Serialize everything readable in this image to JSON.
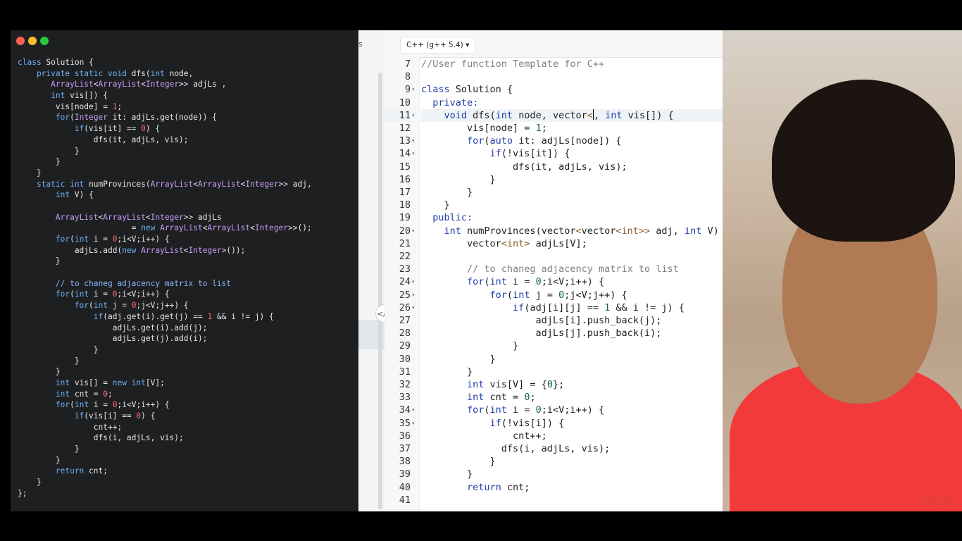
{
  "java_editor": {
    "lines": [
      [
        [
          "class ",
          "k"
        ],
        [
          "Solution",
          ""
        ],
        [
          " {",
          ""
        ]
      ],
      [
        [
          "    private static void ",
          "k"
        ],
        [
          "dfs",
          ""
        ],
        [
          "(",
          ""
        ],
        [
          "int",
          "k"
        ],
        [
          " node,",
          ""
        ]
      ],
      [
        [
          "       ",
          ""
        ],
        [
          "ArrayList",
          "t"
        ],
        [
          "<",
          ""
        ],
        [
          "ArrayList",
          "t"
        ],
        [
          "<",
          ""
        ],
        [
          "Integer",
          "t"
        ],
        [
          ">> adjLs ,",
          ""
        ]
      ],
      [
        [
          "       int",
          "k"
        ],
        [
          " vis[]) {",
          ""
        ]
      ],
      [
        [
          "        vis[node] = ",
          ""
        ],
        [
          "1",
          "n"
        ],
        [
          ";",
          ""
        ]
      ],
      [
        [
          "        for",
          "k"
        ],
        [
          "(",
          ""
        ],
        [
          "Integer",
          "t"
        ],
        [
          " it: adjLs.get(node)) {",
          ""
        ]
      ],
      [
        [
          "            if",
          "k"
        ],
        [
          "(vis[it] == ",
          ""
        ],
        [
          "0",
          "n"
        ],
        [
          ") {",
          ""
        ]
      ],
      [
        [
          "                dfs(it, adjLs, vis);",
          ""
        ]
      ],
      [
        [
          "            }",
          ""
        ]
      ],
      [
        [
          "        }",
          ""
        ]
      ],
      [
        [
          "    }",
          ""
        ]
      ],
      [
        [
          "    static int ",
          "k"
        ],
        [
          "numProvinces",
          ""
        ],
        [
          "(",
          ""
        ],
        [
          "ArrayList",
          "t"
        ],
        [
          "<",
          ""
        ],
        [
          "ArrayList",
          "t"
        ],
        [
          "<",
          ""
        ],
        [
          "Integer",
          "t"
        ],
        [
          ">> adj,",
          ""
        ]
      ],
      [
        [
          "        int",
          "k"
        ],
        [
          " V) {",
          ""
        ]
      ],
      [
        [
          "",
          ""
        ]
      ],
      [
        [
          "        ",
          ""
        ],
        [
          "ArrayList",
          "t"
        ],
        [
          "<",
          ""
        ],
        [
          "ArrayList",
          "t"
        ],
        [
          "<",
          ""
        ],
        [
          "Integer",
          "t"
        ],
        [
          ">> adjLs",
          ""
        ]
      ],
      [
        [
          "                        = ",
          ""
        ],
        [
          "new ",
          "k"
        ],
        [
          "ArrayList",
          "t"
        ],
        [
          "<",
          ""
        ],
        [
          "ArrayList",
          "t"
        ],
        [
          "<",
          ""
        ],
        [
          "Integer",
          "t"
        ],
        [
          ">>();",
          ""
        ]
      ],
      [
        [
          "        for",
          "k"
        ],
        [
          "(",
          ""
        ],
        [
          "int",
          "k"
        ],
        [
          " i = ",
          ""
        ],
        [
          "0",
          "n"
        ],
        [
          ";i<V;i++) {",
          ""
        ]
      ],
      [
        [
          "            adjLs.add(",
          ""
        ],
        [
          "new ",
          "k"
        ],
        [
          "ArrayList",
          "t"
        ],
        [
          "<",
          ""
        ],
        [
          "Integer",
          "t"
        ],
        [
          ">());",
          ""
        ]
      ],
      [
        [
          "        }",
          ""
        ]
      ],
      [
        [
          "",
          ""
        ]
      ],
      [
        [
          "        // to chaneg adjacency matrix to list",
          "c"
        ]
      ],
      [
        [
          "        for",
          "k"
        ],
        [
          "(",
          ""
        ],
        [
          "int",
          "k"
        ],
        [
          " i = ",
          ""
        ],
        [
          "0",
          "n"
        ],
        [
          ";i<V;i++) {",
          ""
        ]
      ],
      [
        [
          "            for",
          "k"
        ],
        [
          "(",
          ""
        ],
        [
          "int",
          "k"
        ],
        [
          " j = ",
          ""
        ],
        [
          "0",
          "n"
        ],
        [
          ";j<V;j++) {",
          ""
        ]
      ],
      [
        [
          "                if",
          "k"
        ],
        [
          "(adj.get(i).get(j) == ",
          ""
        ],
        [
          "1",
          "n"
        ],
        [
          " && i != j) {",
          ""
        ]
      ],
      [
        [
          "                    adjLs.get(i).add(j);",
          ""
        ]
      ],
      [
        [
          "                    adjLs.get(j).add(i);",
          ""
        ]
      ],
      [
        [
          "                }",
          ""
        ]
      ],
      [
        [
          "            }",
          ""
        ]
      ],
      [
        [
          "        }",
          ""
        ]
      ],
      [
        [
          "        int",
          "k"
        ],
        [
          " vis[] = ",
          ""
        ],
        [
          "new int",
          "k"
        ],
        [
          "[V];",
          ""
        ]
      ],
      [
        [
          "        int",
          "k"
        ],
        [
          " cnt = ",
          ""
        ],
        [
          "0",
          "n"
        ],
        [
          ";",
          ""
        ]
      ],
      [
        [
          "        for",
          "k"
        ],
        [
          "(",
          ""
        ],
        [
          "int",
          "k"
        ],
        [
          " i = ",
          ""
        ],
        [
          "0",
          "n"
        ],
        [
          ";i<V;i++) {",
          ""
        ]
      ],
      [
        [
          "            if",
          "k"
        ],
        [
          "(vis[i] == ",
          ""
        ],
        [
          "0",
          "n"
        ],
        [
          ") {",
          ""
        ]
      ],
      [
        [
          "                cnt++;",
          ""
        ]
      ],
      [
        [
          "                dfs(i, adjLs, vis);",
          ""
        ]
      ],
      [
        [
          "            }",
          ""
        ]
      ],
      [
        [
          "        }",
          ""
        ]
      ],
      [
        [
          "        return",
          "k"
        ],
        [
          " cnt;",
          ""
        ]
      ],
      [
        [
          "    }",
          ""
        ]
      ],
      [
        [
          "};",
          ""
        ]
      ]
    ]
  },
  "middle": {
    "edge_text": "s",
    "splitter_icon": "</>"
  },
  "cpp_editor": {
    "language": "C++ (g++ 5.4)",
    "active_line": 11,
    "folds": [
      9,
      11,
      13,
      14,
      20,
      24,
      25,
      26,
      34,
      35
    ],
    "lines": [
      {
        "n": 7,
        "t": [
          [
            "//User function Template for C++",
            "c"
          ]
        ]
      },
      {
        "n": 8,
        "t": [
          [
            "",
            ""
          ]
        ]
      },
      {
        "n": 9,
        "t": [
          [
            "class ",
            "k"
          ],
          [
            "Solution {",
            ""
          ]
        ]
      },
      {
        "n": 10,
        "t": [
          [
            "  private:",
            "k"
          ]
        ]
      },
      {
        "n": 11,
        "t": [
          [
            "    void ",
            "k"
          ],
          [
            "dfs(",
            ""
          ],
          [
            "int",
            "k"
          ],
          [
            " node, vector",
            ""
          ],
          [
            "<",
            "t"
          ],
          [
            "|",
            "caret"
          ],
          [
            ", ",
            ""
          ],
          [
            "int",
            "k"
          ],
          [
            " vis[]) {",
            ""
          ]
        ]
      },
      {
        "n": 12,
        "t": [
          [
            "        vis[node] = ",
            ""
          ],
          [
            "1",
            "n"
          ],
          [
            ";",
            ""
          ]
        ]
      },
      {
        "n": 13,
        "t": [
          [
            "        for",
            "k"
          ],
          [
            "(",
            ""
          ],
          [
            "auto",
            "k"
          ],
          [
            " it: adjLs[node]) {",
            ""
          ]
        ]
      },
      {
        "n": 14,
        "t": [
          [
            "            if",
            "k"
          ],
          [
            "(!vis[it]) {",
            ""
          ]
        ]
      },
      {
        "n": 15,
        "t": [
          [
            "                dfs(it, adjLs, vis);",
            ""
          ]
        ]
      },
      {
        "n": 16,
        "t": [
          [
            "            }",
            ""
          ]
        ]
      },
      {
        "n": 17,
        "t": [
          [
            "        }",
            ""
          ]
        ]
      },
      {
        "n": 18,
        "t": [
          [
            "    }",
            ""
          ]
        ]
      },
      {
        "n": 19,
        "t": [
          [
            "  public:",
            "k"
          ]
        ]
      },
      {
        "n": 20,
        "t": [
          [
            "    int ",
            "k"
          ],
          [
            "numProvinces(vector",
            ""
          ],
          [
            "<",
            "t"
          ],
          [
            "vector",
            ""
          ],
          [
            "<int>>",
            "t"
          ],
          [
            " adj, ",
            ""
          ],
          [
            "int",
            "k"
          ],
          [
            " V)",
            ""
          ]
        ]
      },
      {
        "n": 21,
        "t": [
          [
            "        vector",
            ""
          ],
          [
            "<int>",
            "t"
          ],
          [
            " adjLs[V];",
            ""
          ]
        ]
      },
      {
        "n": 22,
        "t": [
          [
            "",
            ""
          ]
        ]
      },
      {
        "n": 23,
        "t": [
          [
            "        // to chaneg adjacency matrix to list",
            "c"
          ]
        ]
      },
      {
        "n": 24,
        "t": [
          [
            "        for",
            "k"
          ],
          [
            "(",
            ""
          ],
          [
            "int",
            "k"
          ],
          [
            " i = ",
            ""
          ],
          [
            "0",
            "n"
          ],
          [
            ";i<V;i++) {",
            ""
          ]
        ]
      },
      {
        "n": 25,
        "t": [
          [
            "            for",
            "k"
          ],
          [
            "(",
            ""
          ],
          [
            "int",
            "k"
          ],
          [
            " j = ",
            ""
          ],
          [
            "0",
            "n"
          ],
          [
            ";j<V;j++) {",
            ""
          ]
        ]
      },
      {
        "n": 26,
        "t": [
          [
            "                if",
            "k"
          ],
          [
            "(adj[i][j] == ",
            ""
          ],
          [
            "1",
            "n"
          ],
          [
            " && i != j) {",
            ""
          ]
        ]
      },
      {
        "n": 27,
        "t": [
          [
            "                    adjLs[i].push_back(j);",
            ""
          ]
        ]
      },
      {
        "n": 28,
        "t": [
          [
            "                    adjLs[j].push_back(i);",
            ""
          ]
        ]
      },
      {
        "n": 29,
        "t": [
          [
            "                }",
            ""
          ]
        ]
      },
      {
        "n": 30,
        "t": [
          [
            "            }",
            ""
          ]
        ]
      },
      {
        "n": 31,
        "t": [
          [
            "        }",
            ""
          ]
        ]
      },
      {
        "n": 32,
        "t": [
          [
            "        int",
            "k"
          ],
          [
            " vis[V] = {",
            ""
          ],
          [
            "0",
            "n"
          ],
          [
            "};",
            ""
          ]
        ]
      },
      {
        "n": 33,
        "t": [
          [
            "        int",
            "k"
          ],
          [
            " cnt = ",
            ""
          ],
          [
            "0",
            "n"
          ],
          [
            ";",
            ""
          ]
        ]
      },
      {
        "n": 34,
        "t": [
          [
            "        for",
            "k"
          ],
          [
            "(",
            ""
          ],
          [
            "int",
            "k"
          ],
          [
            " i = ",
            ""
          ],
          [
            "0",
            "n"
          ],
          [
            ";i<V;i++) {",
            ""
          ]
        ]
      },
      {
        "n": 35,
        "t": [
          [
            "            if",
            "k"
          ],
          [
            "(!vis[i]) {",
            ""
          ]
        ]
      },
      {
        "n": 36,
        "t": [
          [
            "                cnt++;",
            ""
          ]
        ]
      },
      {
        "n": 37,
        "t": [
          [
            "              dfs(i, adjLs, vis);",
            ""
          ]
        ]
      },
      {
        "n": 38,
        "t": [
          [
            "            }",
            ""
          ]
        ]
      },
      {
        "n": 39,
        "t": [
          [
            "        }",
            ""
          ]
        ]
      },
      {
        "n": 40,
        "t": [
          [
            "        return",
            "k"
          ],
          [
            " cnt;",
            ""
          ]
        ]
      },
      {
        "n": 41,
        "t": [
          [
            "",
            ""
          ]
        ]
      }
    ]
  },
  "webcam": {
    "watermark": "TUF"
  },
  "colors": {
    "accent_red": "#ff5f57",
    "accent_yellow": "#febc2e",
    "accent_green": "#28c840",
    "brand": "#d9443a"
  }
}
